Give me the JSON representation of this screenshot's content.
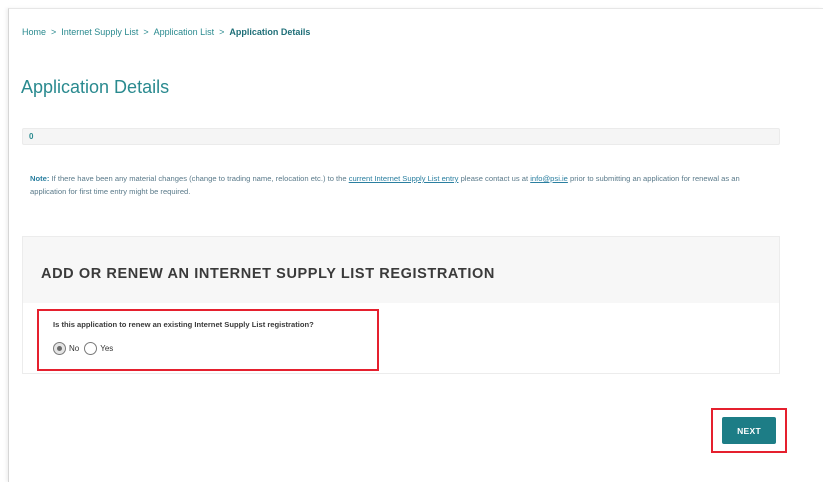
{
  "breadcrumb": {
    "items": [
      "Home",
      "Internet Supply List",
      "Application List"
    ],
    "current": "Application Details",
    "separator": ">"
  },
  "page": {
    "title": "Application Details",
    "status_value": "0"
  },
  "note": {
    "label": "Note:",
    "text_1": " If there have been any material changes (change to trading name, relocation etc.) to the ",
    "link_1": "current Internet Supply List entry",
    "text_2": " please contact us at ",
    "link_2": "info@psi.ie",
    "text_3": " prior to submitting an application for renewal as an application for first time entry might be required."
  },
  "section": {
    "title": "ADD OR RENEW AN INTERNET SUPPLY LIST REGISTRATION",
    "question": "Is this application to renew an existing Internet Supply List registration?",
    "options": [
      {
        "label": "No",
        "selected": true
      },
      {
        "label": "Yes",
        "selected": false
      }
    ]
  },
  "actions": {
    "next_label": "NEXT"
  },
  "colors": {
    "accent": "#2a8a8f",
    "button": "#1d7d86",
    "highlight": "#e5202e"
  }
}
